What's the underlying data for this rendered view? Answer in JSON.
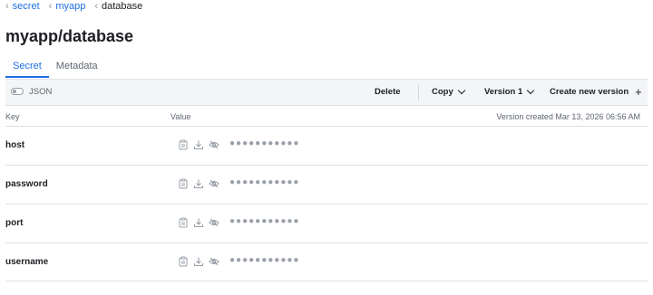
{
  "breadcrumb": [
    {
      "label": "secret"
    },
    {
      "label": "myapp"
    },
    {
      "label": "database"
    }
  ],
  "page_title": "myapp/database",
  "tabs": [
    {
      "label": "Secret",
      "active": true
    },
    {
      "label": "Metadata",
      "active": false
    }
  ],
  "toolbar": {
    "json_toggle_label": "JSON",
    "json_toggle_on": false,
    "delete_label": "Delete",
    "copy_label": "Copy",
    "version_label": "Version 1",
    "create_version_label": "Create new version"
  },
  "table": {
    "key_header": "Key",
    "value_header": "Value",
    "version_info": "Version created Mar 13, 2026 06:56 AM",
    "rows": [
      {
        "key": "host",
        "masked": "●●●●●●●●●●●"
      },
      {
        "key": "password",
        "masked": "●●●●●●●●●●●"
      },
      {
        "key": "port",
        "masked": "●●●●●●●●●●●"
      },
      {
        "key": "username",
        "masked": "●●●●●●●●●●●"
      }
    ]
  },
  "icons": [
    "chevron-left-icon",
    "chevron-down-icon",
    "plus-icon",
    "copy-icon",
    "download-icon",
    "eye-off-icon"
  ]
}
